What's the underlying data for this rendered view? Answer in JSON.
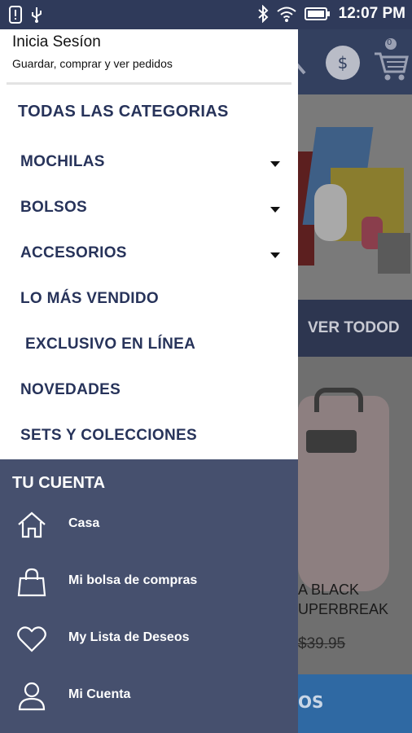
{
  "status_bar": {
    "time": "12:07 PM"
  },
  "drawer": {
    "login": {
      "title": "Inicia Sesíon",
      "subtitle": "Guardar, comprar y ver pedidos"
    },
    "categories": [
      {
        "label": "TODAS LAS CATEGORIAS",
        "has_submenu": false
      },
      {
        "label": "MOCHILAS",
        "has_submenu": true
      },
      {
        "label": "BOLSOS",
        "has_submenu": true
      },
      {
        "label": "ACCESORIOS",
        "has_submenu": true
      },
      {
        "label": "LO MÁS VENDIDO",
        "has_submenu": false
      },
      {
        "label": "EXCLUSIVO EN LÍNEA",
        "has_submenu": false
      },
      {
        "label": "NOVEDADES",
        "has_submenu": false
      },
      {
        "label": "SETS Y COLECCIONES",
        "has_submenu": false
      }
    ],
    "account": {
      "title": "TU CUENTA",
      "items": [
        {
          "label": "Casa",
          "icon": "home-icon"
        },
        {
          "label": "Mi bolsa de compras",
          "icon": "shopping-bag-icon"
        },
        {
          "label": "My Lista de Deseos",
          "icon": "heart-icon"
        },
        {
          "label": "Mi Cuenta",
          "icon": "user-icon"
        }
      ]
    }
  },
  "background": {
    "header": {
      "cart_count": "0",
      "currency_symbol": "$"
    },
    "view_all_label": "VER TODOD",
    "product": {
      "name": "A BLACK\nUPERBREAK",
      "price": "$39.95"
    },
    "bottom_button_label": "OS"
  },
  "colors": {
    "status_bar": "#2f3a5a",
    "nav_text": "#27335a",
    "account_bg": "#46506e",
    "header_bg": "#33405f",
    "button_blue": "#2f69a3"
  }
}
